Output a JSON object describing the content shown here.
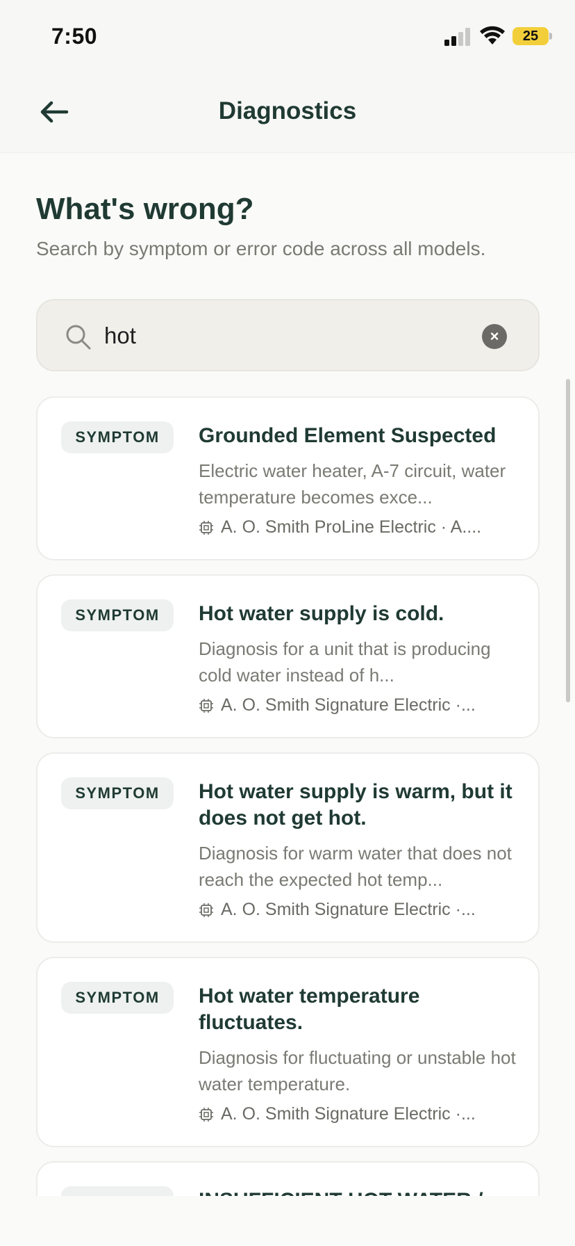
{
  "status": {
    "time": "7:50",
    "battery": "25"
  },
  "header": {
    "title": "Diagnostics"
  },
  "page": {
    "heading": "What's wrong?",
    "subheading": "Search by symptom or error code across all models."
  },
  "search": {
    "value": "hot",
    "clear_icon": "×"
  },
  "results": [
    {
      "badge": "SYMPTOM",
      "title": "Grounded Element Suspected",
      "desc": "Electric water heater, A-7 circuit, water temperature becomes exce...",
      "meta": "A. O. Smith ProLine Electric · A...."
    },
    {
      "badge": "SYMPTOM",
      "title": "Hot water supply is cold.",
      "desc": "Diagnosis for a unit that is producing cold water instead of h...",
      "meta": "A. O. Smith Signature Electric ·..."
    },
    {
      "badge": "SYMPTOM",
      "title": "Hot water supply is warm, but it does not get hot.",
      "desc": "Diagnosis for warm water that does not reach the expected hot temp...",
      "meta": "A. O. Smith Signature Electric ·..."
    },
    {
      "badge": "SYMPTOM",
      "title": "Hot water temperature fluctuates.",
      "desc": "Diagnosis for fluctuating or unstable hot water temperature.",
      "meta": "A. O. Smith Signature Electric ·..."
    },
    {
      "badge": "SYMPTOM",
      "title": "INSUFFICIENT HOT WATER /",
      "desc": "",
      "meta": ""
    }
  ],
  "colors": {
    "accent": "#1f3a33",
    "muted": "#7a7a74",
    "battery": "#f2cf3a"
  }
}
